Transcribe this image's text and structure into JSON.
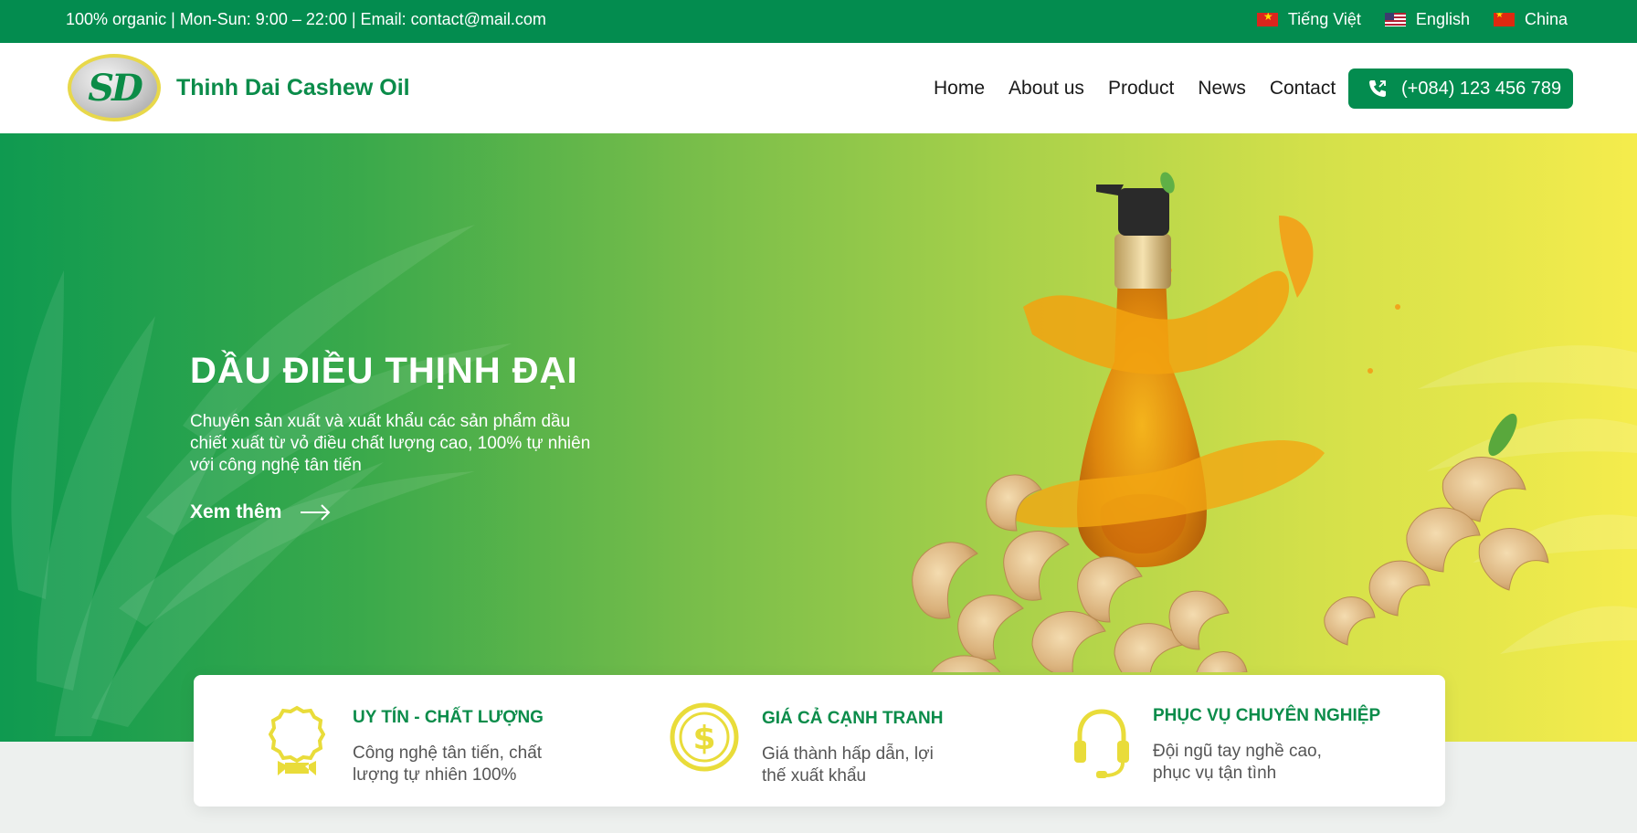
{
  "topbar": {
    "info": "100% organic | Mon-Sun: 9:00 – 22:00 | Email: contact@mail.com",
    "languages": [
      {
        "label": "Tiếng Việt",
        "flag": "vn-flag-icon"
      },
      {
        "label": "English",
        "flag": "us-flag-icon"
      },
      {
        "label": "China",
        "flag": "cn-flag-icon"
      }
    ]
  },
  "header": {
    "logo_text": "SD",
    "brand": "Thinh Dai Cashew Oil",
    "nav": [
      "Home",
      "About us",
      "Product",
      "News",
      "Contact"
    ],
    "phone": "(+084) 123 456 789"
  },
  "hero": {
    "title": "DẦU ĐIỀU THỊNH ĐẠI",
    "description": "Chuyên sản xuất và xuất khẩu các sản phẩm dầu chiết xuất từ vỏ điều chất lượng cao, 100% tự nhiên với công nghệ tân tiến",
    "cta": "Xem thêm"
  },
  "features": [
    {
      "icon": "medal-icon",
      "title": "UY TÍN - CHẤT LƯỢNG",
      "description": "Công nghệ tân tiến, chất lượng tự nhiên 100%"
    },
    {
      "icon": "dollar-coin-icon",
      "title": "GIÁ CẢ CẠNH TRANH",
      "description": "Giá thành hấp dẫn, lợi thế xuất khẩu"
    },
    {
      "icon": "headset-icon",
      "title": "PHỤC VỤ CHUYÊN NGHIỆP",
      "description": "Đội ngũ tay nghề cao, phục vụ tận tình"
    }
  ],
  "colors": {
    "brand_green": "#038c4f",
    "accent_yellow": "#e9dc3a"
  }
}
